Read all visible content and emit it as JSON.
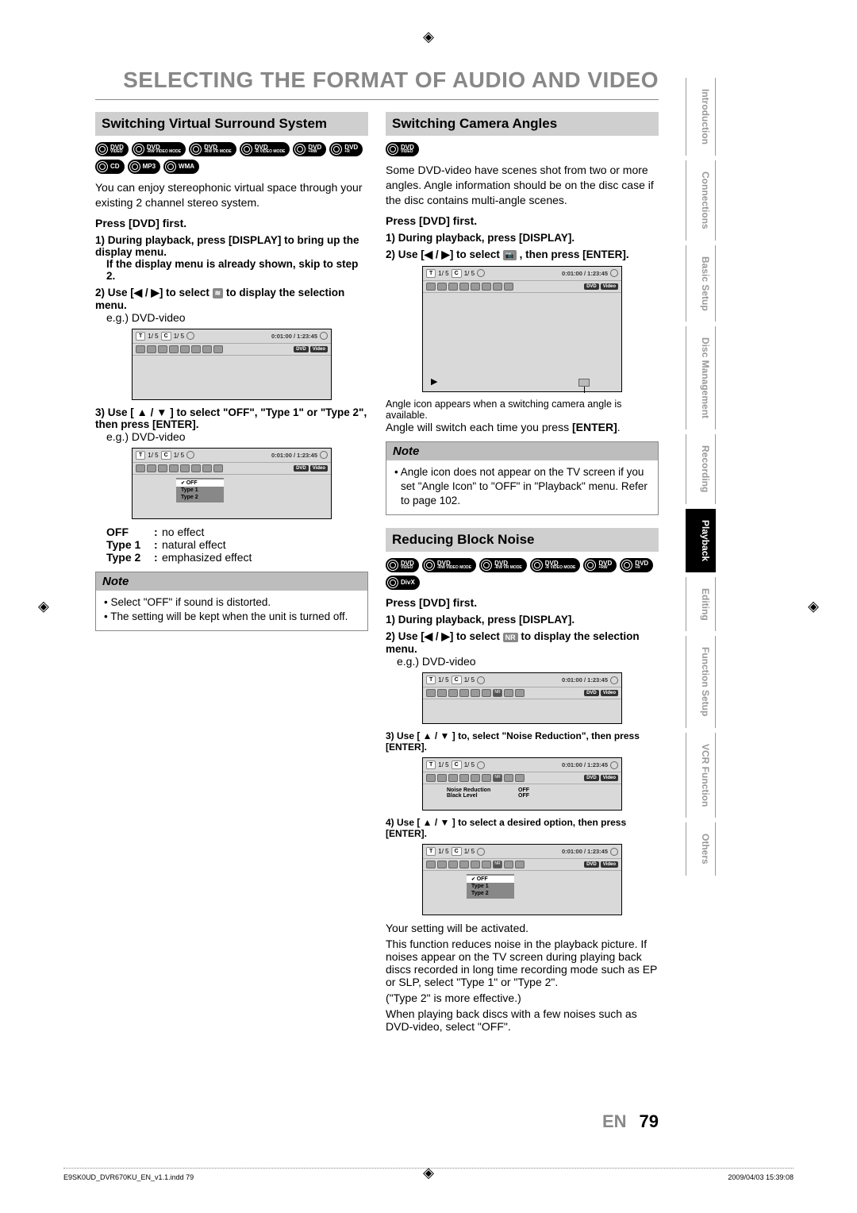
{
  "page_title": "SELECTING THE FORMAT OF AUDIO AND VIDEO",
  "tabs": [
    "Introduction",
    "Connections",
    "Basic Setup",
    "Disc Management",
    "Recording",
    "Playback",
    "Editing",
    "Function Setup",
    "VCR Function",
    "Others"
  ],
  "active_tab": "Playback",
  "footer": {
    "left": "E9SK0UD_DVR670KU_EN_v1.1.indd   79",
    "right": "2009/04/03   15:39:08"
  },
  "page_num": {
    "lang": "EN",
    "num": "79"
  },
  "osd_common": {
    "t_left": "1/   5",
    "c_right": "1/   5",
    "time": "0:01:00 / 1:23:45",
    "tag1": "DVD",
    "tag2": "Video"
  },
  "left": {
    "heading": "Switching Virtual Surround System",
    "formats": [
      "DVD|VIDEO",
      "DVD|-RW VIDEO MODE",
      "DVD|-RW VR MODE",
      "DVD|-R VIDEO MODE",
      "DVD|+RW",
      "DVD|+R",
      "CD|",
      "MP3|",
      "WMA|"
    ],
    "intro": "You can enjoy stereophonic virtual space through your existing 2 channel stereo system.",
    "press": "Press [DVD] first.",
    "s1a": "1) During playback, press [DISPLAY] to bring up the display menu.",
    "s1b": "If the display menu is already shown, skip to step 2.",
    "s2a": "2) Use [",
    "s2b": "] to select",
    "s2c": "to display the selection menu.",
    "s2icon": "≋",
    "eg": "e.g.) DVD-video",
    "s3": "3) Use [ ▲ / ▼ ] to select \"OFF\", \"Type 1\" or \"Type 2\", then press [ENTER].",
    "menu_items": [
      "OFF",
      "Type 1",
      "Type 2"
    ],
    "effects": [
      {
        "lbl": "OFF",
        "val": "no effect"
      },
      {
        "lbl": "Type 1",
        "val": "natural effect"
      },
      {
        "lbl": "Type 2",
        "val": "emphasized effect"
      }
    ],
    "note_head": "Note",
    "notes": [
      "Select \"OFF\" if sound is distorted.",
      "The setting will be kept when the unit is turned off."
    ]
  },
  "right_a": {
    "heading": "Switching Camera Angles",
    "formats": [
      "DVD|VIDEO"
    ],
    "intro": "Some DVD-video have scenes shot from two or more angles. Angle information should be on the disc case if the disc contains multi-angle scenes.",
    "press": "Press [DVD] first.",
    "s1": "1) During playback, press [DISPLAY].",
    "s2a": "2) Use [",
    "s2b": "] to select",
    "s2c": ", then press [ENTER].",
    "s2icon": "📷",
    "after1": "Angle icon appears when a switching camera angle is available.",
    "after2": "Angle will switch each time you press [ENTER].",
    "note_head": "Note",
    "notes": [
      "Angle icon does not appear on the TV screen if you set \"Angle Icon\" to \"OFF\" in \"Playback\" menu. Refer to page 102."
    ]
  },
  "right_b": {
    "heading": "Reducing Block Noise",
    "formats": [
      "DVD|VIDEO",
      "DVD|-RW VIDEO MODE",
      "DVD|-RW VR MODE",
      "DVD|-R VIDEO MODE",
      "DVD|+RW",
      "DVD|+R",
      "DivX|"
    ],
    "press": "Press [DVD] first.",
    "s1": "1) During playback, press [DISPLAY].",
    "s2a": "2) Use [",
    "s2b": "] to select",
    "s2c": "to display the selection menu.",
    "s2icon": "NR",
    "eg": "e.g.) DVD-video",
    "s3": "3) Use [ ▲ / ▼ ] to, select \"Noise Reduction\", then press [ENTER].",
    "kv": [
      {
        "k": "Noise Reduction",
        "v": "OFF"
      },
      {
        "k": "Black Level",
        "v": "OFF"
      }
    ],
    "s4": "4) Use [ ▲ / ▼ ] to select a desired option, then press [ENTER].",
    "menu_items": [
      "OFF",
      "Type 1",
      "Type 2"
    ],
    "p1": "Your setting will be activated.",
    "p2": "This function reduces noise in the playback picture. If noises appear on the TV screen during playing back discs recorded in long time recording mode such as EP or SLP, select \"Type 1\" or \"Type 2\".",
    "p3": "(\"Type 2\" is more effective.)",
    "p4": "When playing back discs with a few noises such as DVD-video, select \"OFF\"."
  }
}
